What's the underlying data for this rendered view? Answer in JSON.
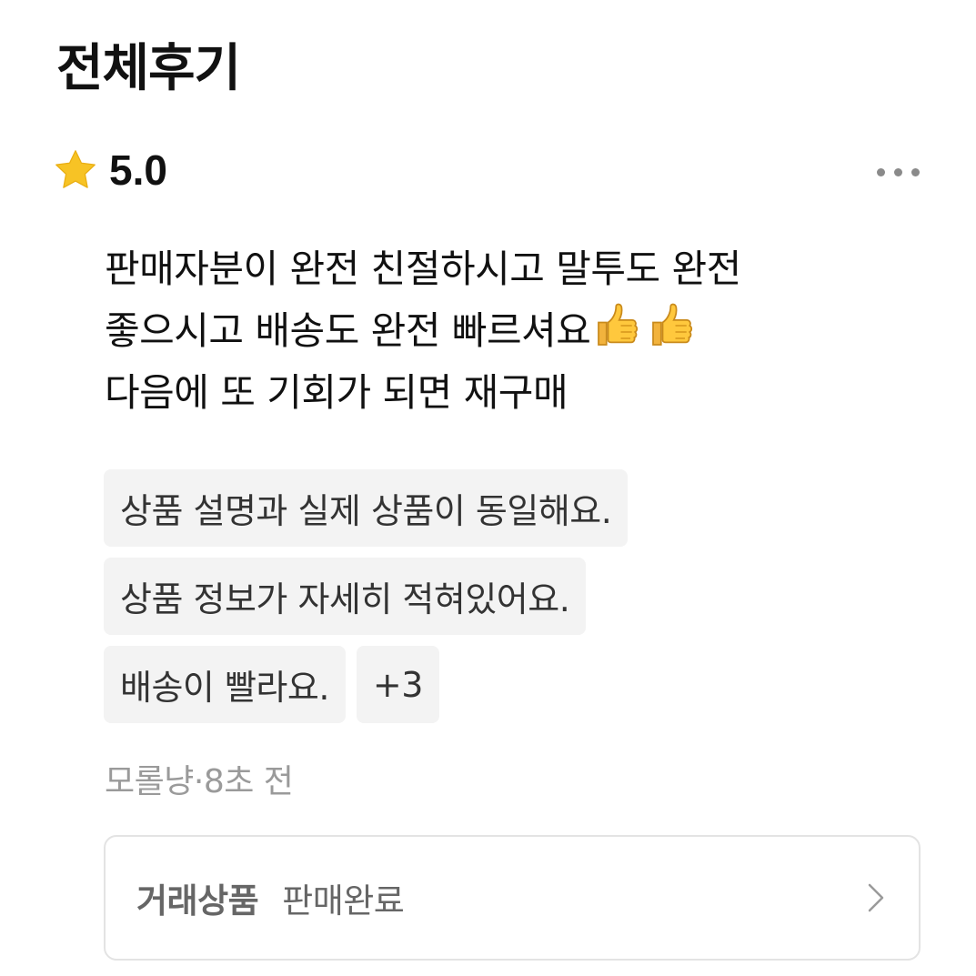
{
  "header": {
    "title": "전체후기"
  },
  "review": {
    "rating": "5.0",
    "icons": {
      "star": "star-icon",
      "more": "more-options-icon",
      "thumb": "thumbs-up-icon"
    },
    "body_lines": [
      "판매자분이 완전 친절하시고 말투도 완전",
      "좋으시고 배송도 완전 빠르셔요",
      "다음에 또 기회가 되면 재구매"
    ],
    "tags": [
      "상품 설명과 실제 상품이 동일해요.",
      "상품 정보가 자세히 적혀있어요.",
      "배송이 빨라요."
    ],
    "more_tags": "+3",
    "author": "모롤냥",
    "separator": "·",
    "time": "8초 전"
  },
  "product": {
    "label": "거래상품",
    "status": "판매완료",
    "chevron_icon": "chevron-right-icon"
  },
  "colors": {
    "star": "#F7C325",
    "tag_bg": "#F3F3F3",
    "meta_text": "#9A9A9A",
    "card_border": "#E3E3E3"
  }
}
